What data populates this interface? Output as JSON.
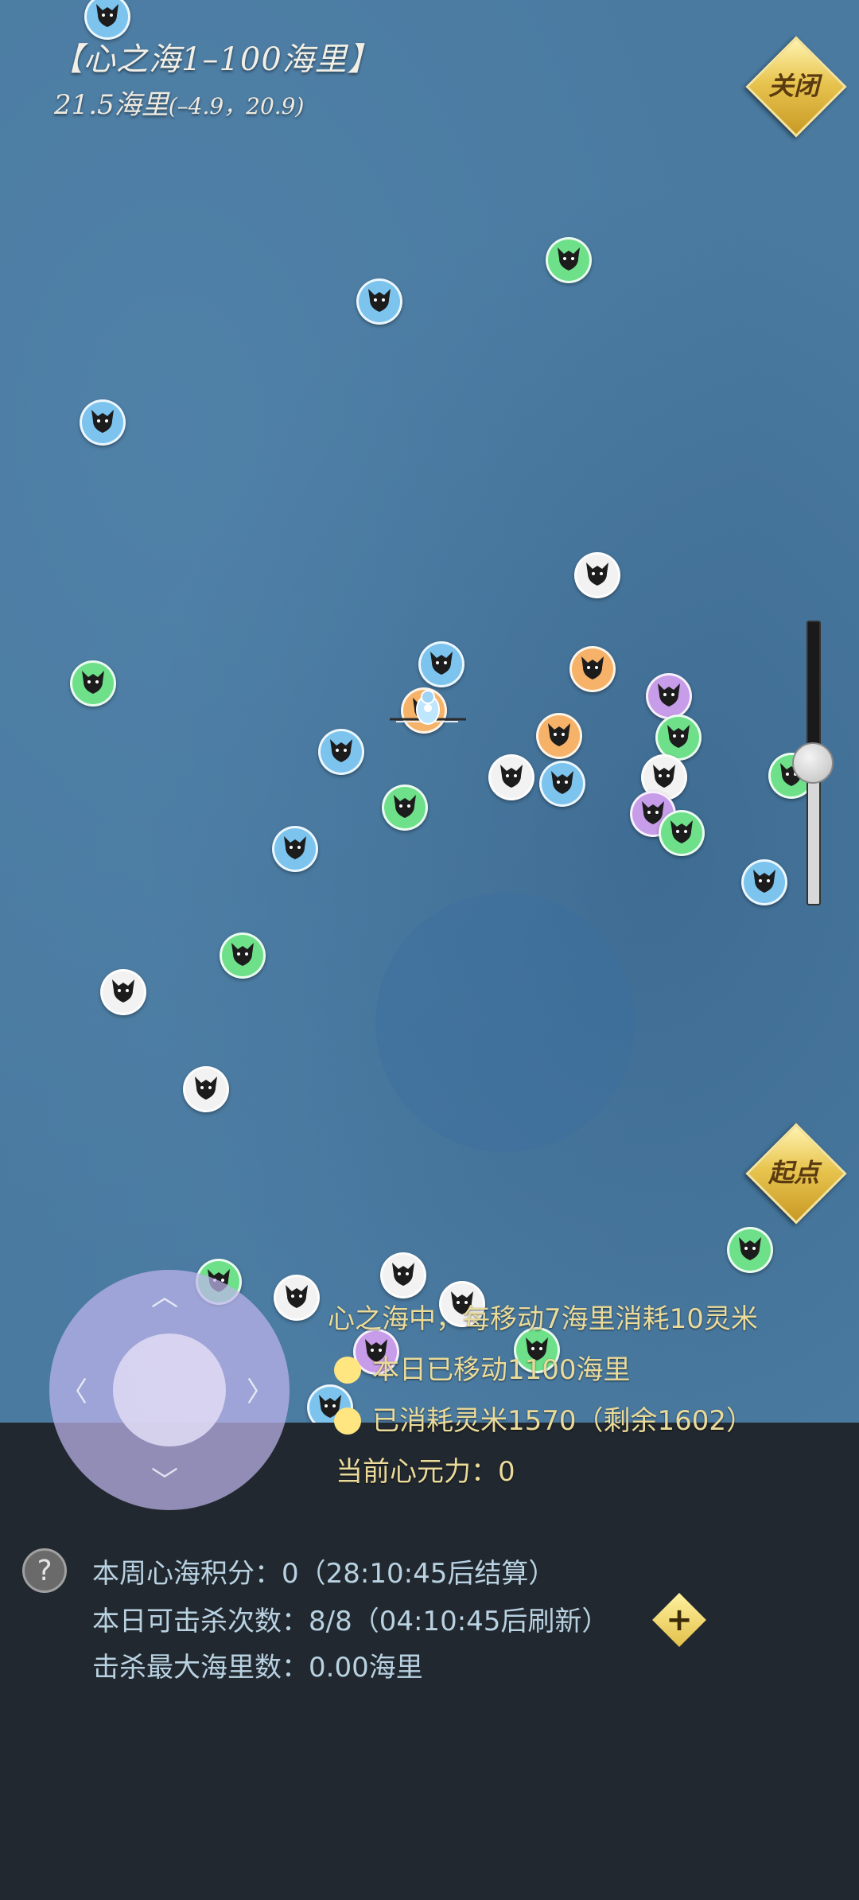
{
  "header": {
    "region_title": "【心之海1–100海里】",
    "distance": "21.5海里",
    "coordinates": "(–4.9，20.9)"
  },
  "buttons": {
    "close_label": "关闭",
    "origin_label": "起点",
    "plus_label": "+",
    "help_label": "?"
  },
  "map": {
    "monster_icon": "wolf-head-icon",
    "zoom_level": 0.5
  },
  "movement_info": {
    "rule": "心之海中，每移动7海里消耗10灵米",
    "moved_today": "本日已移动1100海里",
    "rice_consumed": "已消耗灵米1570（剩余1602）",
    "heart_power": "当前心元力：0"
  },
  "stats_panel": {
    "weekly_score": "本周心海积分：0（28:10:45后结算）",
    "kills_today": "本日可击杀次数：8/8（04:10:45后刷新）",
    "max_distance": "击杀最大海里数：0.00海里"
  },
  "colors": {
    "sea": "#4a7aa0",
    "panel": "#22282f",
    "accent_gold": "#e8c550",
    "marker_blue": "#7cc4ee",
    "marker_green": "#6ee08a",
    "marker_white": "#f2f2f2",
    "marker_orange": "#f5b268",
    "marker_purple": "#c79ce8"
  }
}
